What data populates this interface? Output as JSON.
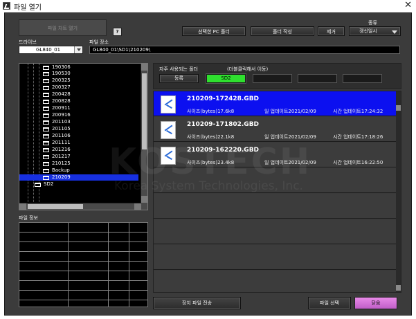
{
  "window": {
    "title": "파일 열기"
  },
  "top": {
    "open_chart_label": "파일 차트 열기",
    "help_label": "?",
    "drive_label": "드라이브",
    "drive_value": "GL840_01",
    "path_label": "파일 장소",
    "path_value": "GL840_01\\SD1\\210209\\",
    "select_pc_folder_label": "선택한 PC 폴더",
    "create_folder_label": "폴더 작성",
    "remove_label": "제거",
    "sort_label": "종류",
    "sort_value": "갱신일시"
  },
  "tree": {
    "items": [
      {
        "label": "190306"
      },
      {
        "label": "190530"
      },
      {
        "label": "200325"
      },
      {
        "label": "200327"
      },
      {
        "label": "200428"
      },
      {
        "label": "200828"
      },
      {
        "label": "200911"
      },
      {
        "label": "200916"
      },
      {
        "label": "201103"
      },
      {
        "label": "201105"
      },
      {
        "label": "201106"
      },
      {
        "label": "201111"
      },
      {
        "label": "201216"
      },
      {
        "label": "201217"
      },
      {
        "label": "210125"
      },
      {
        "label": "Backup"
      },
      {
        "label": "210209",
        "selected": true
      },
      {
        "label": "SD2"
      }
    ]
  },
  "info": {
    "label": "파일 정보"
  },
  "favorites": {
    "title": "자주 사용되는 폴더",
    "hint": "(더블클릭해서 이동)",
    "register_label": "등록",
    "slots": [
      "SD2",
      "",
      "",
      "",
      ""
    ]
  },
  "files": [
    {
      "name": "210209-172428.GBD",
      "size": "사이즈(bytes)17.6k8",
      "date": "일 업데이트2021/02/09",
      "time": "시간 업데이트17:24:32",
      "selected": true
    },
    {
      "name": "210209-171802.GBD",
      "size": "사이즈(bytes)22.1k8",
      "date": "일 업데이트2021/02/09",
      "time": "시간 업데이트17:18:26",
      "selected": false
    },
    {
      "name": "210209-162220.GBD",
      "size": "사이즈(bytes)23.4k8",
      "date": "일 업데이트2021/02/09",
      "time": "시간 업데이트16:22:50",
      "selected": false
    }
  ],
  "watermark": {
    "brand": "KOSTECH",
    "tagline": "Korea System Technologies, Inc."
  },
  "bottom": {
    "transfer_label": "장치 파일 전송",
    "file_select_label": "파일 선택",
    "close_label": "닫음"
  }
}
